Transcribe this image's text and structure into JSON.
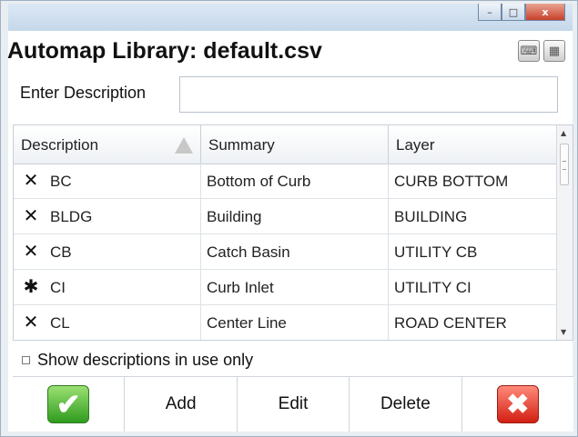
{
  "window": {
    "title": "Automap Library: default.csv",
    "controls": {
      "minimize": "–",
      "maximize": "□",
      "close": "x"
    },
    "keyboard_icon": "⌨",
    "grid_icon": "▦"
  },
  "entry": {
    "label": "Enter Description",
    "value": "",
    "placeholder": ""
  },
  "table": {
    "columns": [
      "Description",
      "Summary",
      "Layer"
    ],
    "rows": [
      {
        "mark": "✕",
        "description": "BC",
        "summary": "Bottom of Curb",
        "layer": "CURB BOTTOM"
      },
      {
        "mark": "✕",
        "description": "BLDG",
        "summary": "Building",
        "layer": "BUILDING"
      },
      {
        "mark": "✕",
        "description": "CB",
        "summary": "Catch Basin",
        "layer": "UTILITY CB"
      },
      {
        "mark": "✱",
        "description": "CI",
        "summary": "Curb Inlet",
        "layer": "UTILITY CI"
      },
      {
        "mark": "✕",
        "description": "CL",
        "summary": "Center Line",
        "layer": "ROAD CENTER"
      }
    ]
  },
  "options": {
    "show_in_use_label": "Show descriptions in use only",
    "show_in_use_checked": false
  },
  "toolbar": {
    "ok_glyph": "✔",
    "add_label": "Add",
    "edit_label": "Edit",
    "delete_label": "Delete",
    "cancel_glyph": "✖"
  }
}
